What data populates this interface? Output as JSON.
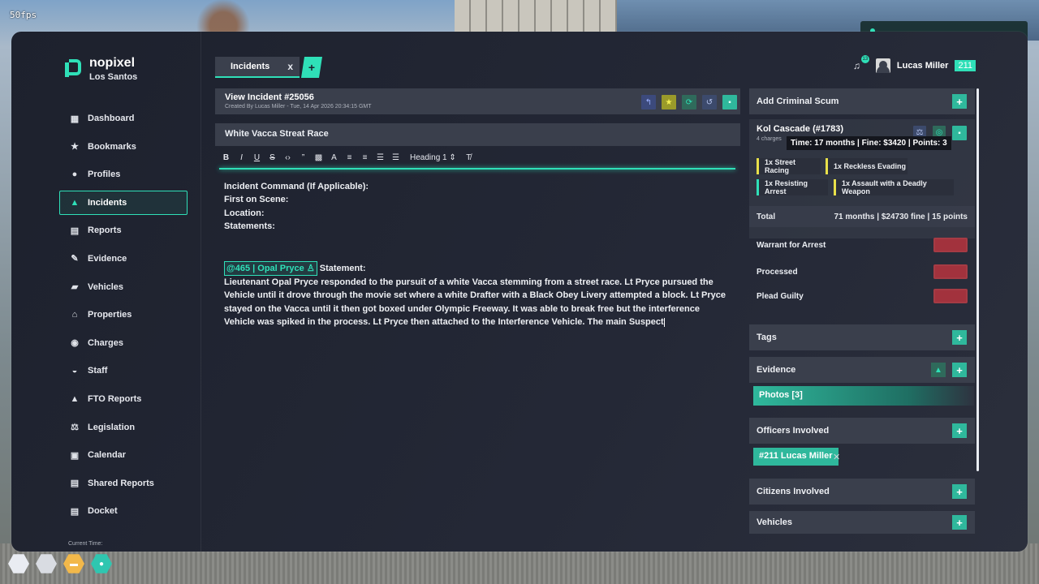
{
  "fps": "50fps",
  "logo": {
    "title": "nopixel",
    "subtitle": "Los Santos"
  },
  "nav": [
    {
      "label": "Dashboard",
      "icon": "dashboard-icon",
      "glyph": "▦"
    },
    {
      "label": "Bookmarks",
      "icon": "star-icon",
      "glyph": "★"
    },
    {
      "label": "Profiles",
      "icon": "person-icon",
      "glyph": "●"
    },
    {
      "label": "Incidents",
      "icon": "warning-icon",
      "glyph": "▲",
      "active": true
    },
    {
      "label": "Reports",
      "icon": "document-icon",
      "glyph": "▤"
    },
    {
      "label": "Evidence",
      "icon": "fingerprint-icon",
      "glyph": "✎"
    },
    {
      "label": "Vehicles",
      "icon": "car-icon",
      "glyph": "▰"
    },
    {
      "label": "Properties",
      "icon": "house-icon",
      "glyph": "⌂"
    },
    {
      "label": "Charges",
      "icon": "location-icon",
      "glyph": "◉"
    },
    {
      "label": "Staff",
      "icon": "cap-icon",
      "glyph": "◒"
    },
    {
      "label": "FTO Reports",
      "icon": "graduation-icon",
      "glyph": "▲"
    },
    {
      "label": "Legislation",
      "icon": "gavel-icon",
      "glyph": "⚖"
    },
    {
      "label": "Calendar",
      "icon": "calendar-icon",
      "glyph": "▣"
    },
    {
      "label": "Shared Reports",
      "icon": "shared-document-icon",
      "glyph": "▤"
    },
    {
      "label": "Docket",
      "icon": "docket-icon",
      "glyph": "▤"
    }
  ],
  "current_time_label": "Current Time:",
  "tab": {
    "label": "Incidents",
    "close": "x",
    "add": "+"
  },
  "user": {
    "notifications": "13",
    "name": "Lucas Miller",
    "badge": "211"
  },
  "incident": {
    "title": "View Incident #25056",
    "meta": "Created By Lucas Miller - Tue, 14 Apr 2026 20:34:15 GMT",
    "name": "White Vacca Streat Race"
  },
  "toolbar": {
    "heading": "Heading 1"
  },
  "editor": {
    "lines": [
      "Incident Command (If Applicable):",
      "First on Scene:",
      "Location:",
      "Statements:"
    ],
    "mention": "@465 | Opal Pryce",
    "statement_label": "Statement:",
    "body": "Lieutenant Opal Pryce responded to the pursuit of a white Vacca stemming from a street race. Lt Pryce pursued the Vehicle until it drove through the movie set where a white Drafter with a Black Obey Livery attempted a block. Lt Pryce stayed on the Vacca until it then got boxed under Olympic Freeway. It was able to break free but the interference Vehicle was spiked in the process. Lt Pryce then attached to the Interference Vehicle. The main Suspect"
  },
  "right": {
    "add_criminal": "Add Criminal Scum",
    "scum_name": "Kol Cascade (#1783)",
    "scum_sub": "4 charges",
    "tooltip": "Time: 17 months | Fine: $3420 | Points: 3",
    "charges": [
      "1x Street Racing",
      "1x Reckless Evading",
      "1x Resisting Arrest",
      "1x Assault with a Deadly Weapon"
    ],
    "total_label": "Total",
    "total_value": "71 months | $24730 fine | 15 points",
    "warrant": "Warrant for Arrest",
    "processed": "Processed",
    "plead": "Plead Guilty",
    "tags": "Tags",
    "evidence": "Evidence",
    "photos": "Photos [3]",
    "officers": "Officers Involved",
    "officer_chip": "#211 Lucas Miller",
    "citizens": "Citizens Involved",
    "vehicles": "Vehicles"
  },
  "colors": {
    "accent": "#2fe0b8",
    "panel": "#1d212d",
    "toggle_off": "#b8343e"
  }
}
